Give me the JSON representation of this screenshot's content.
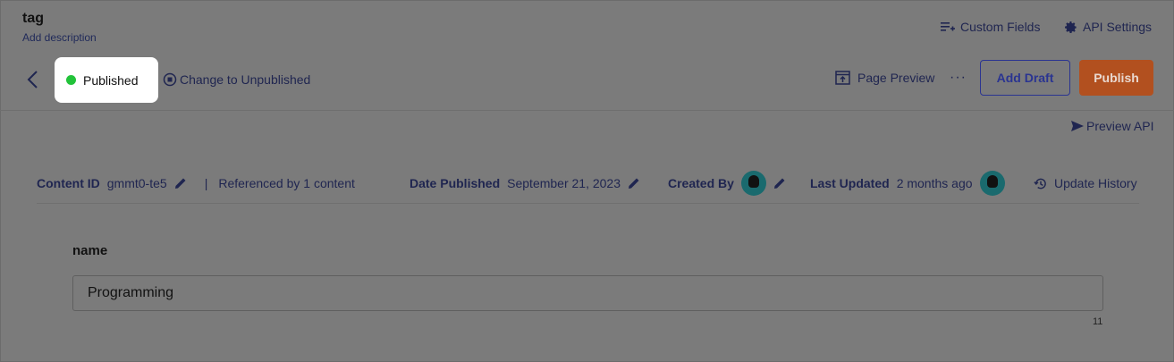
{
  "header": {
    "title": "tag",
    "description": "Add description",
    "custom_fields_label": "Custom Fields",
    "api_settings_label": "API Settings"
  },
  "toolbar": {
    "status_label": "Published",
    "status_color": "#22c33a",
    "change_status_label": "Change to Unpublished",
    "page_preview_label": "Page Preview",
    "more_label": "···",
    "add_draft_label": "Add Draft",
    "publish_label": "Publish",
    "preview_api_label": "Preview API"
  },
  "meta": {
    "content_id_key": "Content ID",
    "content_id_value": "gmmt0-te5",
    "separator": "|",
    "referenced": "Referenced by 1 content",
    "date_published_key": "Date Published",
    "date_published_value": "September 21, 2023",
    "created_by_key": "Created By",
    "last_updated_key": "Last Updated",
    "last_updated_value": "2 months ago",
    "update_history_label": "Update History"
  },
  "form": {
    "field_label": "name",
    "field_value": "Programming",
    "char_count": "11"
  },
  "colors": {
    "publish_button": "#b2501f",
    "draft_border": "#2a3491",
    "overlay_bg": "#7b7b7b"
  }
}
